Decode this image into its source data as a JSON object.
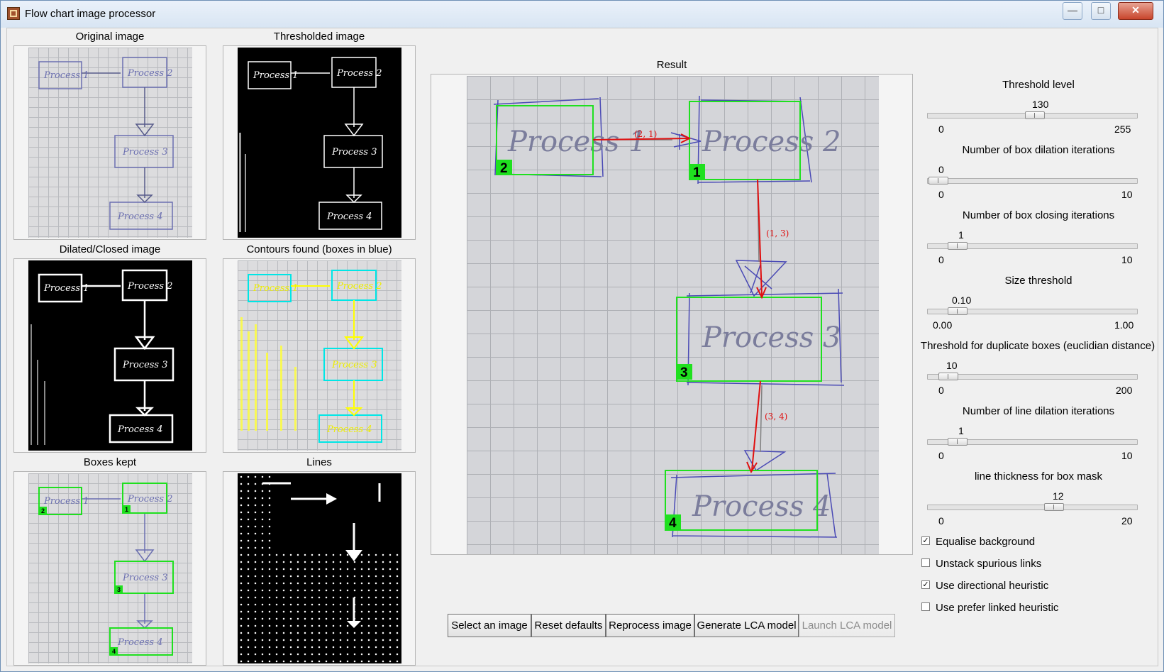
{
  "window": {
    "title": "Flow chart image processor",
    "controls": {
      "minimize": "—",
      "maximize": "□",
      "close": "✕"
    }
  },
  "panels": {
    "original": "Original image",
    "thresholded": "Thresholded image",
    "dilated": "Dilated/Closed image",
    "contours": "Contours found (boxes in blue)",
    "boxes_kept": "Boxes kept",
    "lines": "Lines",
    "result": "Result"
  },
  "sketch": {
    "process_labels": [
      "Process 1",
      "Process 2",
      "Process 3",
      "Process 4"
    ],
    "box_ids": [
      "1",
      "2",
      "3",
      "4"
    ],
    "links": [
      "(2, 1)",
      "(1, 3)",
      "(3, 4)"
    ]
  },
  "controls": {
    "threshold_level": {
      "label": "Threshold level",
      "value": 130,
      "min": 0,
      "max": 255,
      "value_text": "130",
      "min_text": "0",
      "max_text": "255"
    },
    "box_dilation": {
      "label": "Number of box dilation iterations",
      "value": 0,
      "min": 0,
      "max": 10,
      "value_text": "0",
      "min_text": "0",
      "max_text": "10"
    },
    "box_closing": {
      "label": "Number of box closing iterations",
      "value": 1,
      "min": 0,
      "max": 10,
      "value_text": "1",
      "min_text": "0",
      "max_text": "10"
    },
    "size_threshold": {
      "label": "Size threshold",
      "value": 0.1,
      "min": 0,
      "max": 1,
      "value_text": "0.10",
      "min_text": "0.00",
      "max_text": "1.00"
    },
    "duplicate_threshold": {
      "label": "Threshold for duplicate boxes (euclidian distance)",
      "value": 10,
      "min": 0,
      "max": 200,
      "value_text": "10",
      "min_text": "0",
      "max_text": "200"
    },
    "line_dilation": {
      "label": "Number of line dilation iterations",
      "value": 1,
      "min": 0,
      "max": 10,
      "value_text": "1",
      "min_text": "0",
      "max_text": "10"
    },
    "line_thickness": {
      "label": "line thickness for box mask",
      "value": 12,
      "min": 0,
      "max": 20,
      "value_text": "12",
      "min_text": "0",
      "max_text": "20"
    }
  },
  "checkboxes": [
    {
      "label": "Equalise background",
      "checked": true
    },
    {
      "label": "Unstack spurious links",
      "checked": false
    },
    {
      "label": "Use directional heuristic",
      "checked": true
    },
    {
      "label": "Use prefer linked heuristic",
      "checked": false
    }
  ],
  "buttons": {
    "select": "Select an image",
    "reset": "Reset defaults",
    "reprocess": "Reprocess image",
    "generate": "Generate LCA model",
    "launch": "Launch LCA model"
  },
  "colors": {
    "box_green": "#1fe01f",
    "link_red": "#e01010",
    "ink_blue": "#4a4ab5",
    "contour_yellow": "#ffff00",
    "contour_cyan": "#00e6e6"
  },
  "icons": {
    "app": "flowchart-app-icon",
    "check": "✓"
  }
}
